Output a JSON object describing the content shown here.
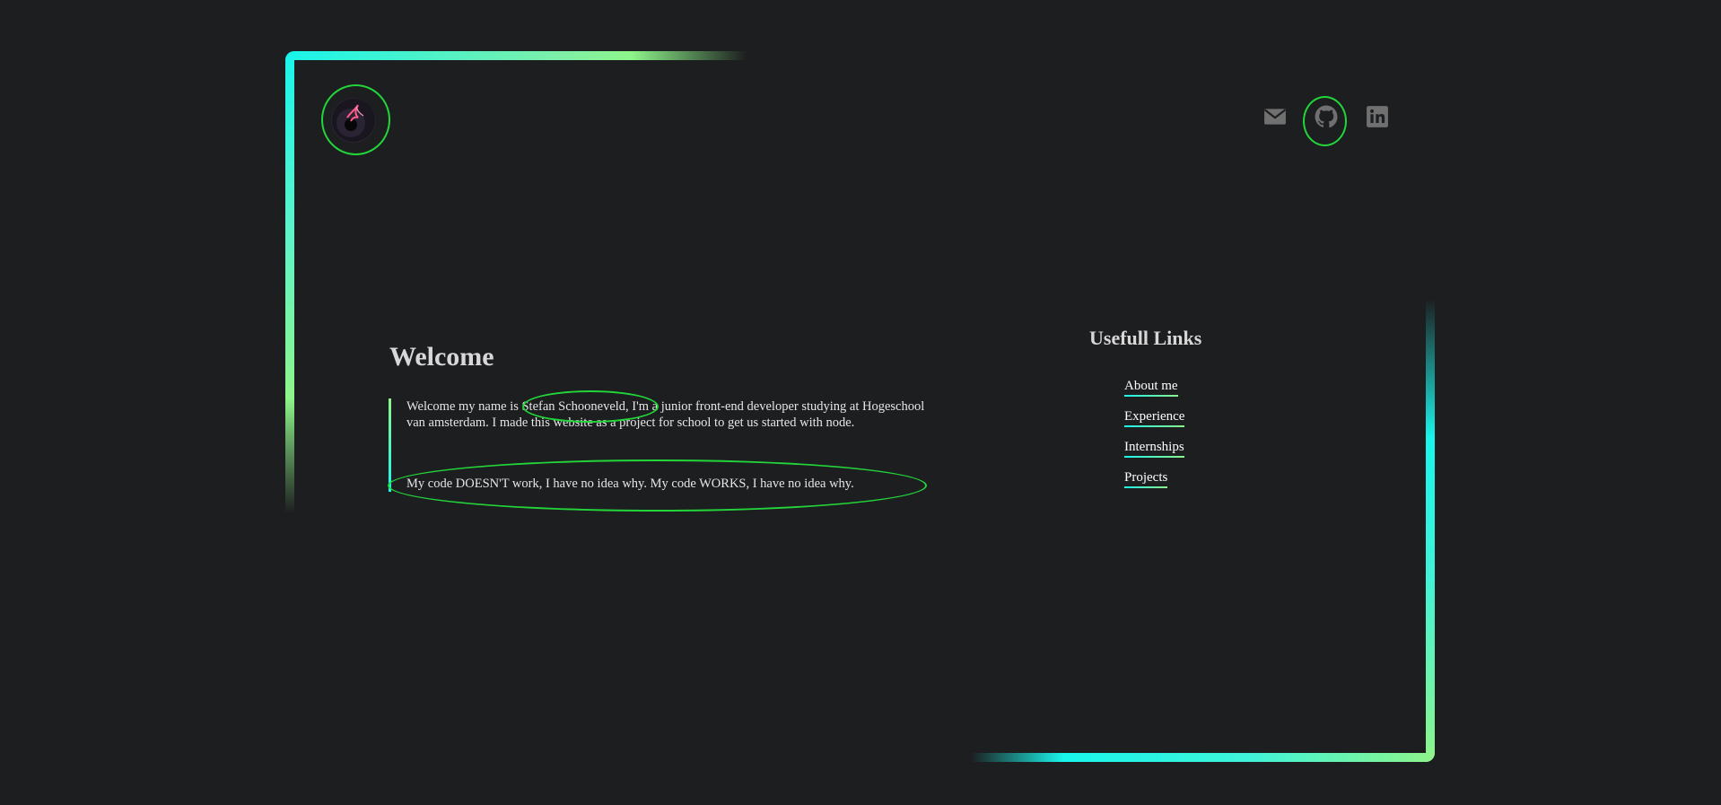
{
  "brand": {
    "logo_icon": "avatar-logo-icon"
  },
  "social": [
    {
      "name": "mail-icon",
      "label": "Email"
    },
    {
      "name": "github-icon",
      "label": "GitHub"
    },
    {
      "name": "linkedin-icon",
      "label": "LinkedIn"
    }
  ],
  "colors": {
    "background": "#1d1e20",
    "accent_cyan": "#19f5ec",
    "accent_green": "#8ef58a",
    "annotation": "#22d63a",
    "icon_gray": "#707070"
  },
  "main": {
    "title": "Welcome",
    "intro": "Welcome my name is Stefan Schooneveld, I'm a junior front-end developer studying at Hogeschool van amsterdam. I made this website as a project for school to get us started with node.",
    "quote": "My code DOESN'T work, I have no idea why. My code WORKS, I have no idea why."
  },
  "links": {
    "title": "Usefull Links",
    "items": [
      {
        "label": "About me"
      },
      {
        "label": "Experience"
      },
      {
        "label": "Internships"
      },
      {
        "label": "Projects"
      }
    ]
  }
}
